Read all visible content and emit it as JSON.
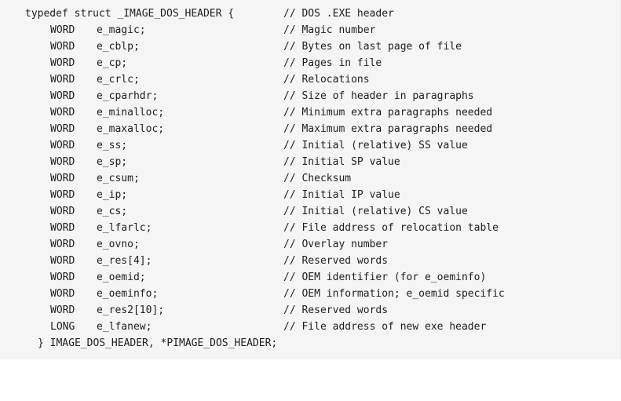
{
  "code": {
    "opening_line": "typedef struct _IMAGE_DOS_HEADER {",
    "opening_comment": "// DOS .EXE header",
    "closing_line": "} IMAGE_DOS_HEADER, *PIMAGE_DOS_HEADER;",
    "fields": [
      {
        "type": "WORD",
        "name": "e_magic;",
        "comment": "// Magic number"
      },
      {
        "type": "WORD",
        "name": "e_cblp;",
        "comment": "// Bytes on last page of file"
      },
      {
        "type": "WORD",
        "name": "e_cp;",
        "comment": "// Pages in file"
      },
      {
        "type": "WORD",
        "name": "e_crlc;",
        "comment": "// Relocations"
      },
      {
        "type": "WORD",
        "name": "e_cparhdr;",
        "comment": "// Size of header in paragraphs"
      },
      {
        "type": "WORD",
        "name": "e_minalloc;",
        "comment": "// Minimum extra paragraphs needed"
      },
      {
        "type": "WORD",
        "name": "e_maxalloc;",
        "comment": "// Maximum extra paragraphs needed"
      },
      {
        "type": "WORD",
        "name": "e_ss;",
        "comment": "// Initial (relative) SS value"
      },
      {
        "type": "WORD",
        "name": "e_sp;",
        "comment": "// Initial SP value"
      },
      {
        "type": "WORD",
        "name": "e_csum;",
        "comment": "// Checksum"
      },
      {
        "type": "WORD",
        "name": "e_ip;",
        "comment": "// Initial IP value"
      },
      {
        "type": "WORD",
        "name": "e_cs;",
        "comment": "// Initial (relative) CS value"
      },
      {
        "type": "WORD",
        "name": "e_lfarlc;",
        "comment": "// File address of relocation table"
      },
      {
        "type": "WORD",
        "name": "e_ovno;",
        "comment": "// Overlay number"
      },
      {
        "type": "WORD",
        "name": "e_res[4];",
        "comment": "// Reserved words"
      },
      {
        "type": "WORD",
        "name": "e_oemid;",
        "comment": "// OEM identifier (for e_oeminfo)"
      },
      {
        "type": "WORD",
        "name": "e_oeminfo;",
        "comment": "// OEM information; e_oemid specific"
      },
      {
        "type": "WORD",
        "name": "e_res2[10];",
        "comment": "// Reserved words"
      },
      {
        "type": "LONG",
        "name": "e_lfanew;",
        "comment": "// File address of new exe header"
      }
    ]
  }
}
